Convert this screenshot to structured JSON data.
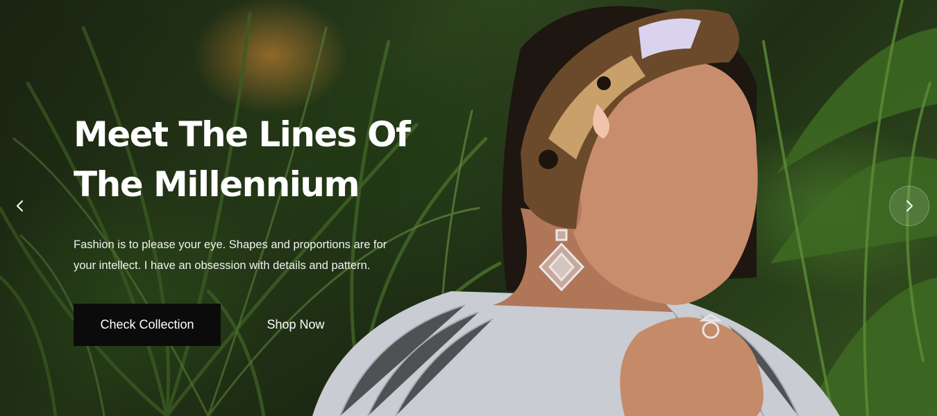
{
  "hero": {
    "headline_line1": "Meet The Lines Of",
    "headline_line2": "The Millennium",
    "subtext_line1": "Fashion is to please your eye. Shapes and proportions are for",
    "subtext_line2": "your intellect. I have an obsession with details and pattern.",
    "primary_cta": "Check Collection",
    "secondary_cta": "Shop Now"
  },
  "carousel": {
    "prev_icon": "chevron-left-icon",
    "next_icon": "chevron-right-icon"
  },
  "colors": {
    "button_bg": "#0b0b0b",
    "text": "#ffffff"
  }
}
